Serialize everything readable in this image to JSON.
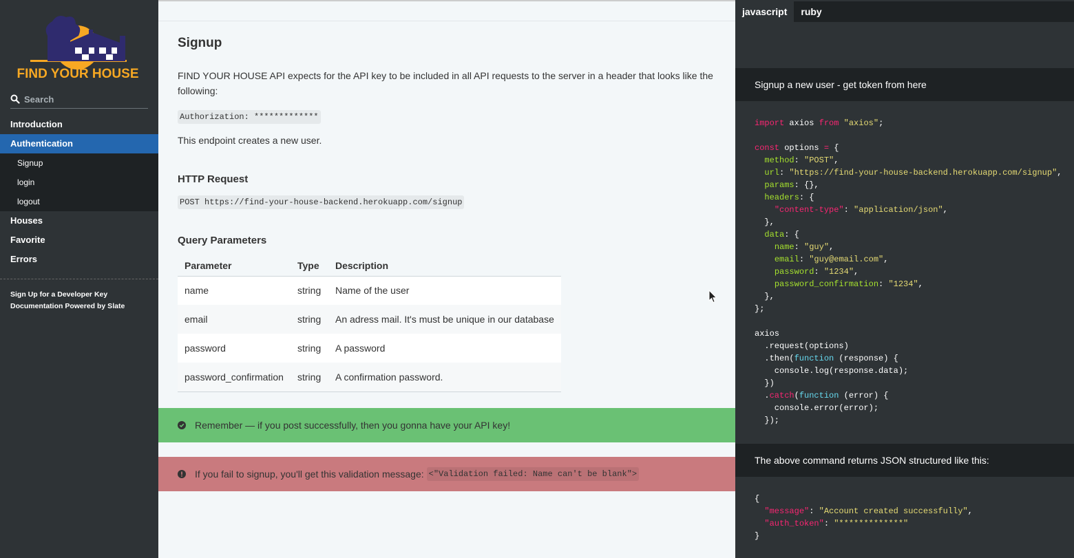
{
  "sidebar": {
    "logo_text": "FIND YOUR HOUSE",
    "search_placeholder": "Search",
    "items": [
      {
        "label": "Introduction"
      },
      {
        "label": "Authentication"
      },
      {
        "label": "Houses"
      },
      {
        "label": "Favorite"
      },
      {
        "label": "Errors"
      }
    ],
    "sub_items": [
      "Signup",
      "login",
      "logout"
    ],
    "footer": [
      "Sign Up for a Developer Key",
      "Documentation Powered by Slate"
    ]
  },
  "main": {
    "title": "Signup",
    "intro": "FIND YOUR HOUSE API expects for the API key to be included in all API requests to the server in a header that looks like the following:",
    "auth_header": "Authorization: *************",
    "endpoint_desc": "This endpoint creates a new user.",
    "http_request_heading": "HTTP Request",
    "http_request": "POST https://find-your-house-backend.herokuapp.com/signup",
    "query_params_heading": "Query Parameters",
    "table": {
      "headers": [
        "Parameter",
        "Type",
        "Description"
      ],
      "rows": [
        [
          "name",
          "string",
          "Name of the user"
        ],
        [
          "email",
          "string",
          "An adress mail. It's must be unique in our database"
        ],
        [
          "password",
          "string",
          "A password"
        ],
        [
          "password_confirmation",
          "string",
          "A confirmation password."
        ]
      ]
    },
    "success_notice": "Remember — if you post successfully, then you gonna have your API key!",
    "warning_notice": "If you fail to signup, you'll get this validation message:",
    "warning_code": "<\"Validation failed: Name can't be blank\">"
  },
  "code_panel": {
    "tabs": [
      "javascript",
      "ruby"
    ],
    "active_tab": "javascript",
    "header1": "Signup a new user - get token from here",
    "header2": "The above command returns JSON structured like this:",
    "js_lines": [
      "import axios from \"axios\";",
      "",
      "const options = {",
      "  method: \"POST\",",
      "  url: \"https://find-your-house-backend.herokuapp.com/signup\",",
      "  params: {},",
      "  headers: {",
      "    \"content-type\": \"application/json\",",
      "  },",
      "  data: {",
      "    name: \"guy\",",
      "    email: \"guy@email.com\",",
      "    password: \"1234\",",
      "    password_confirmation: \"1234\",",
      "  },",
      "};",
      "",
      "axios",
      "  .request(options)",
      "  .then(function (response) {",
      "    console.log(response.data);",
      "  })",
      "  .catch(function (error) {",
      "    console.error(error);",
      "  });"
    ],
    "json_lines": [
      "{",
      "  \"message\": \"Account created successfully\",",
      "  \"auth_token\": \"*************\"",
      "}"
    ]
  },
  "colors": {
    "sidebar_bg": "#2e3336",
    "active_item": "#2467af",
    "success": "#6ac174",
    "warning": "#c97a7e",
    "logo_orange": "#f7a823",
    "logo_navy": "#2f2b6e"
  }
}
